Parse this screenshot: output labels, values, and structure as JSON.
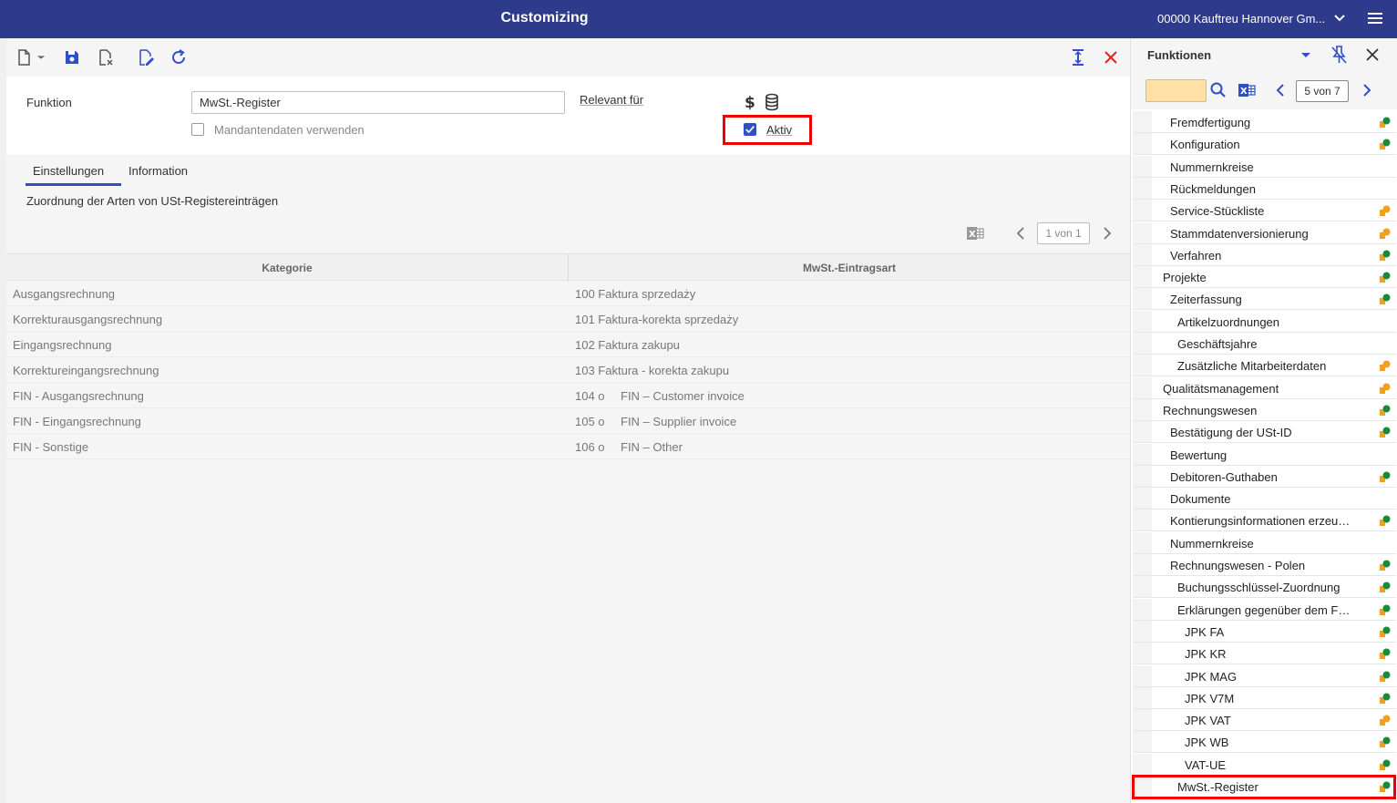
{
  "header": {
    "title": "Customizing",
    "company": "00000  Kauftreu Hannover Gm..."
  },
  "toolbar": {
    "icons": [
      "new-document-icon",
      "dropdown-arrow-icon",
      "save-icon",
      "discard-icon",
      "edit-document-icon",
      "refresh-icon",
      "expand-vertical-icon",
      "close-icon"
    ]
  },
  "form": {
    "funktion_label": "Funktion",
    "funktion_value": "MwSt.-Register",
    "mandanten_label": "Mandantendaten verwenden",
    "mandanten_checked": false,
    "relevant_label": "Relevant für",
    "aktiv_label": "Aktiv",
    "aktiv_checked": true
  },
  "tabs": [
    {
      "label": "Einstellungen",
      "active": true
    },
    {
      "label": "Information",
      "active": false
    }
  ],
  "section": {
    "description": "Zuordnung der Arten von USt-Registereinträgen",
    "pager": "1 von 1"
  },
  "table": {
    "columns": [
      "Kategorie",
      "MwSt.-Eintragsart"
    ],
    "rows": [
      {
        "kategorie": "Ausgangsrechnung",
        "code": "100 Faktura sprzedaży",
        "desc": ""
      },
      {
        "kategorie": "Korrekturausgangsrechnung",
        "code": "101 Faktura-korekta sprzedaży",
        "desc": ""
      },
      {
        "kategorie": "Eingangsrechnung",
        "code": "102 Faktura zakupu",
        "desc": ""
      },
      {
        "kategorie": "Korrektureingangsrechnung",
        "code": "103 Faktura - korekta zakupu",
        "desc": ""
      },
      {
        "kategorie": "FIN - Ausgangsrechnung",
        "code": "104 o",
        "desc": "FIN – Customer invoice"
      },
      {
        "kategorie": "FIN - Eingangsrechnung",
        "code": "105 o",
        "desc": "FIN – Supplier invoice"
      },
      {
        "kategorie": "FIN - Sonstige",
        "code": "106 o",
        "desc": "FIN – Other"
      }
    ]
  },
  "functions_panel": {
    "title": "Funktionen",
    "search_value": "",
    "counter": "5 von 7",
    "items": [
      {
        "label": "Fremdfertigung",
        "level": 2,
        "status": "green"
      },
      {
        "label": "Konfiguration",
        "level": 2,
        "status": "green"
      },
      {
        "label": "Nummernkreise",
        "level": 2,
        "status": "none"
      },
      {
        "label": "Rückmeldungen",
        "level": 2,
        "status": "none"
      },
      {
        "label": "Service-Stückliste",
        "level": 2,
        "status": "orange"
      },
      {
        "label": "Stammdatenversionierung",
        "level": 2,
        "status": "orange"
      },
      {
        "label": "Verfahren",
        "level": 2,
        "status": "green"
      },
      {
        "label": "Projekte",
        "level": 1,
        "status": "green"
      },
      {
        "label": "Zeiterfassung",
        "level": 2,
        "status": "green"
      },
      {
        "label": "Artikelzuordnungen",
        "level": 3,
        "status": "none"
      },
      {
        "label": "Geschäftsjahre",
        "level": 3,
        "status": "none"
      },
      {
        "label": "Zusätzliche Mitarbeiterdaten",
        "level": 3,
        "status": "orange"
      },
      {
        "label": "Qualitätsmanagement",
        "level": 1,
        "status": "orange"
      },
      {
        "label": "Rechnungswesen",
        "level": 1,
        "status": "green"
      },
      {
        "label": "Bestätigung der USt-ID",
        "level": 2,
        "status": "green"
      },
      {
        "label": "Bewertung",
        "level": 2,
        "status": "none"
      },
      {
        "label": "Debitoren-Guthaben",
        "level": 2,
        "status": "green"
      },
      {
        "label": "Dokumente",
        "level": 2,
        "status": "none"
      },
      {
        "label": "Kontierungsinformationen erzeugen",
        "level": 2,
        "status": "green"
      },
      {
        "label": "Nummernkreise",
        "level": 2,
        "status": "none"
      },
      {
        "label": "Rechnungswesen - Polen",
        "level": 2,
        "status": "green"
      },
      {
        "label": "Buchungsschlüssel-Zuordnung",
        "level": 3,
        "status": "green"
      },
      {
        "label": "Erklärungen gegenüber dem Finanz...",
        "level": 3,
        "status": "green"
      },
      {
        "label": "JPK FA",
        "level": 4,
        "status": "green"
      },
      {
        "label": "JPK KR",
        "level": 4,
        "status": "green"
      },
      {
        "label": "JPK MAG",
        "level": 4,
        "status": "green"
      },
      {
        "label": "JPK V7M",
        "level": 4,
        "status": "green"
      },
      {
        "label": "JPK VAT",
        "level": 4,
        "status": "orange"
      },
      {
        "label": "JPK WB",
        "level": 4,
        "status": "green"
      },
      {
        "label": "VAT-UE",
        "level": 4,
        "status": "green"
      },
      {
        "label": "MwSt.-Register",
        "level": 3,
        "status": "green"
      }
    ]
  },
  "colors": {
    "header_bg": "#2e3a8c",
    "accent": "#2f4fc8",
    "highlight": "#e00000",
    "status_green": "#1a8a3a",
    "status_orange": "#f0a020"
  }
}
